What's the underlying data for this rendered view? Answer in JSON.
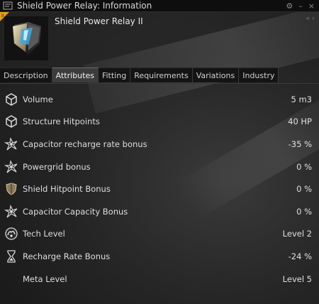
{
  "window": {
    "title": "Shield Power Relay: Information",
    "controls": [
      "⚙",
      "–",
      "×"
    ]
  },
  "item": {
    "name": "Shield Power Relay II",
    "tech_badge": "II"
  },
  "tabs": [
    {
      "label": "Description",
      "active": false
    },
    {
      "label": "Attributes",
      "active": true
    },
    {
      "label": "Fitting",
      "active": false
    },
    {
      "label": "Requirements",
      "active": false
    },
    {
      "label": "Variations",
      "active": false
    },
    {
      "label": "Industry",
      "active": false
    }
  ],
  "attributes": [
    {
      "icon": "cube-icon",
      "label": "Volume",
      "value": "5 m3"
    },
    {
      "icon": "cube-icon",
      "label": "Structure Hitpoints",
      "value": "40 HP"
    },
    {
      "icon": "capacitor-icon",
      "label": "Capacitor recharge rate bonus",
      "value": "-35 %"
    },
    {
      "icon": "capacitor-icon",
      "label": "Powergrid bonus",
      "value": "0 %"
    },
    {
      "icon": "shield-icon",
      "label": "Shield Hitpoint Bonus",
      "value": "0 %"
    },
    {
      "icon": "capacitor-icon",
      "label": "Capacitor Capacity Bonus",
      "value": "0 %"
    },
    {
      "icon": "tech-level-icon",
      "label": "Tech Level",
      "value": "Level 2"
    },
    {
      "icon": "hourglass-icon",
      "label": "Recharge Rate Bonus",
      "value": "-24 %"
    },
    {
      "icon": "",
      "label": "Meta Level",
      "value": "Level 5"
    }
  ],
  "colors": {
    "tech_badge": "#e0a020",
    "active_tab": "#3c3c3c"
  }
}
